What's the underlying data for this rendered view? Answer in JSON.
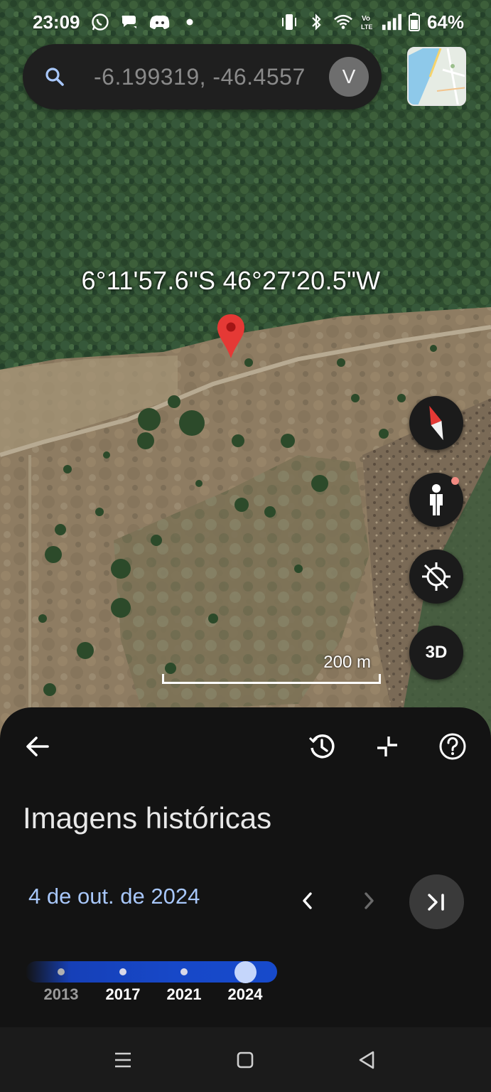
{
  "status_bar": {
    "time": "23:09",
    "battery": "64%",
    "left_icons": [
      "whatsapp-icon",
      "chat-bubbles-icon",
      "discord-icon",
      "notification-dot-icon"
    ],
    "right_icons": [
      "vibrate-icon",
      "bluetooth-icon",
      "wifi-icon",
      "volte-icon",
      "signal-icon",
      "battery-icon"
    ]
  },
  "search": {
    "value": "-6.199319, -46.4557",
    "avatar_initial": "V",
    "icon": "search-icon"
  },
  "map": {
    "pin_label": "6°11'57.6\"S 46°27'20.5\"W",
    "scale_label": "200 m",
    "buttons": [
      "compass",
      "street-view",
      "my-location",
      "3D"
    ],
    "button_3d_label": "3D",
    "street_view_has_notification": true
  },
  "history_panel": {
    "title": "Imagens históricas",
    "selected_date": "4 de out. de 2024",
    "toolbar_icons": [
      "back-arrow-icon",
      "history-icon",
      "collapse-icon",
      "help-icon"
    ],
    "timeline": {
      "years": [
        "2013",
        "2017",
        "2021",
        "2024"
      ],
      "selected_year": "2024"
    }
  },
  "colors": {
    "date_accent": "#a8c7fa",
    "timeline_blue": "#1748c8",
    "pin_red": "#e53935",
    "sheet_bg": "#131313"
  },
  "nav_bar": {
    "icons": [
      "recents-icon",
      "home-icon",
      "back-icon"
    ]
  }
}
